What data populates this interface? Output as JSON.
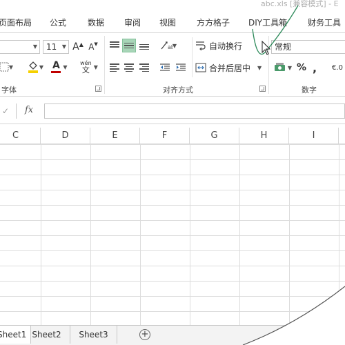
{
  "title_bar": {
    "document_title": "abc.xls [兼容模式] - E"
  },
  "menu_tabs": [
    "页面布局",
    "公式",
    "数据",
    "审阅",
    "视图",
    "方方格子",
    "DIY工具箱",
    "财务工具"
  ],
  "font_group": {
    "label": "字体",
    "font_size_value": "11",
    "grow_font_label": "A",
    "shrink_font_label": "A",
    "font_color_label": "A",
    "phonetic_label": "wén",
    "fill_color": "#f5d000",
    "font_color": "#c00000"
  },
  "alignment_group": {
    "label": "对齐方式",
    "wrap_text_label": "自动换行",
    "merge_center_label": "合并后居中"
  },
  "number_group": {
    "label": "数字",
    "format_value": "常规",
    "percent_label": "%",
    "comma_label": ",",
    "decimal_label": "€.0"
  },
  "formula_bar": {
    "fx_label": "fx",
    "cancel_label": "✓",
    "formula_value": ""
  },
  "columns": [
    "C",
    "D",
    "E",
    "F",
    "G",
    "H",
    "I"
  ],
  "sheets": [
    "Sheet1",
    "Sheet2",
    "Sheet3"
  ],
  "add_sheet_label": "+",
  "colors": {
    "accent_selected": "#a8d5b8",
    "annotation_stroke": "#2d8a5a"
  }
}
